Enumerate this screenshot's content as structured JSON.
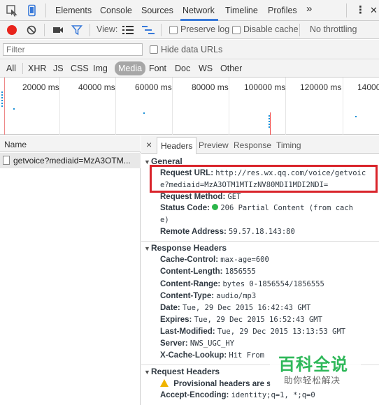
{
  "tabs": {
    "items": [
      "Elements",
      "Console",
      "Sources",
      "Network",
      "Timeline",
      "Profiles"
    ],
    "active": "Network",
    "more": "»",
    "menu": "⋮",
    "close": "✕"
  },
  "toolbar": {
    "view_label": "View:",
    "preserve_log": "Preserve log",
    "disable_cache": "Disable cache",
    "throttling": "No throttling"
  },
  "filter": {
    "placeholder": "Filter",
    "hide_data_urls": "Hide data URLs"
  },
  "types": {
    "items": [
      "All",
      "XHR",
      "JS",
      "CSS",
      "Img",
      "Media",
      "Font",
      "Doc",
      "WS",
      "Other"
    ],
    "active": "Media"
  },
  "overview": {
    "ticks": [
      "20000 ms",
      "40000 ms",
      "60000 ms",
      "80000 ms",
      "100000 ms",
      "120000 ms",
      "14000"
    ]
  },
  "requests": {
    "column": "Name",
    "rows": [
      {
        "name": "getvoice?mediaid=MzA3OTM..."
      }
    ]
  },
  "detail": {
    "close": "×",
    "tabs": [
      "Headers",
      "Preview",
      "Response",
      "Timing"
    ],
    "active_tab": "Headers",
    "general": {
      "title": "General",
      "request_url_key": "Request URL:",
      "request_url_line1": "http://res.wx.qq.com/voice/getvoic",
      "request_url_line2": "e?mediaid=MzA3OTM1MTIzNV80MDI1MDI2NDI=",
      "request_method_key": "Request Method:",
      "request_method_val": "GET",
      "status_code_key": "Status Code:",
      "status_code_line1": "206 Partial Content (from cach",
      "status_code_line2": "e)",
      "status_color": "#2bb54a",
      "remote_address_key": "Remote Address:",
      "remote_address_val": "59.57.18.143:80"
    },
    "response_headers": {
      "title": "Response Headers",
      "rows": [
        {
          "key": "Cache-Control:",
          "val": "max-age=600"
        },
        {
          "key": "Content-Length:",
          "val": "1856555"
        },
        {
          "key": "Content-Range:",
          "val": "bytes 0-1856554/1856555"
        },
        {
          "key": "Content-Type:",
          "val": "audio/mp3"
        },
        {
          "key": "Date:",
          "val": "Tue, 29 Dec 2015 16:42:43 GMT"
        },
        {
          "key": "Expires:",
          "val": "Tue, 29 Dec 2015 16:52:43 GMT"
        },
        {
          "key": "Last-Modified:",
          "val": "Tue, 29 Dec 2015 13:13:53 GMT"
        },
        {
          "key": "Server:",
          "val": "NWS_UGC_HY"
        },
        {
          "key": "X-Cache-Lookup:",
          "val": "Hit From"
        }
      ]
    },
    "request_headers": {
      "title": "Request Headers",
      "provisional": "Provisional headers are s",
      "accept_encoding_key": "Accept-Encoding:",
      "accept_encoding_val": "identity;q=1, *;q=0"
    }
  },
  "watermark": {
    "title": "百科全说",
    "subtitle": "助你轻松解决"
  },
  "colors": {
    "highlight": "#d9242b",
    "accent": "#3879d9",
    "record": "#e8241c"
  }
}
